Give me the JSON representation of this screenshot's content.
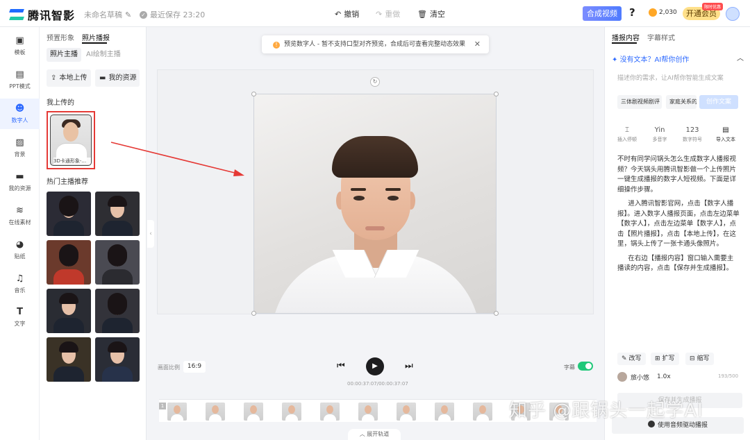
{
  "app": {
    "logo_text": "腾讯智影",
    "draft_name": "未命名草稿",
    "save_status": "最近保存 23:20"
  },
  "toolbar": {
    "undo": "撤销",
    "redo": "重做",
    "clear": "清空",
    "compose": "合成视频",
    "help": "?",
    "coins": "2,030",
    "vip": "开通会员",
    "vip_tag": "限时优惠"
  },
  "nav": [
    {
      "label": "模板",
      "icon": "template-icon"
    },
    {
      "label": "PPT模式",
      "icon": "ppt-icon"
    },
    {
      "label": "数字人",
      "icon": "digital-human-icon",
      "active": true
    },
    {
      "label": "背景",
      "icon": "background-icon"
    },
    {
      "label": "我的资源",
      "icon": "folder-icon"
    },
    {
      "label": "在线素材",
      "icon": "layers-icon"
    },
    {
      "label": "贴纸",
      "icon": "sticker-icon"
    },
    {
      "label": "音乐",
      "icon": "music-icon"
    },
    {
      "label": "文字",
      "icon": "text-icon"
    }
  ],
  "panel": {
    "tabs": [
      "预置形象",
      "照片播报"
    ],
    "active_tab": "照片播报",
    "sub_tabs": [
      "照片主播",
      "AI绘制主播"
    ],
    "upload_btn": "本地上传",
    "resource_btn": "我的资源",
    "uploaded_title": "我上传的",
    "uploaded_item": "3D卡通形象-...",
    "hot_title": "热门主播推荐"
  },
  "notice": {
    "text": "预览数字人 - 暂不支持口型对齐预览，合成后可查看完整动态效果"
  },
  "player": {
    "ratio_label": "画面比例",
    "ratio_value": "16:9",
    "timecode": "00:00:37:07/00:00:37:07",
    "subtitle_label": "字幕",
    "subtitle_on": true,
    "expand_track": "展开轨道",
    "track_index": "1"
  },
  "watermark": "知乎 @跟锅头一起学AI",
  "right_panel": {
    "tabs": [
      "播报内容",
      "字幕样式"
    ],
    "active_tab": "播报内容",
    "ai_prompt": "没有文本？AI帮你创作",
    "ai_placeholder": "描述你的需求，让AI帮你智能生成文案",
    "chips": [
      "三体剧视频剧评",
      "家庭关系的"
    ],
    "generate_btn": "创作文案",
    "tools": [
      {
        "label": "插入停顿",
        "glyph": "⌶"
      },
      {
        "label": "多音字",
        "glyph": "Yin"
      },
      {
        "label": "数字符号",
        "glyph": "123"
      },
      {
        "label": "导入文本",
        "glyph": "▤"
      }
    ],
    "script": [
      "不时有同学问锅头怎么生成数字人播报视频？今天锅头用腾讯智影做一个上传照片一键生成播报的数字人短视频。下面是详细操作步骤。",
      "进入腾讯智影官网，点击【数字人播报】。进入数字人播报页面，点击左边菜单【数字人】，点击左边菜单【数字人】，点击【照片播报】，点击【本地上传】，在这里，锅头上传了一张卡通头像照片。",
      "在右边【播报内容】窗口输入需要主播读的内容，点击【保存并生成播报】。"
    ],
    "edit_tools": [
      "改写",
      "扩写",
      "缩写"
    ],
    "voice_name": "旅小悠",
    "voice_speed": "1.0x",
    "char_count": "193/500",
    "save_btn": "保存并生成播报",
    "audio_btn": "使用音频驱动播报"
  },
  "colors": {
    "accent": "#2f6bff",
    "highlight_box": "#e53935",
    "toggle_on": "#21c87a"
  }
}
